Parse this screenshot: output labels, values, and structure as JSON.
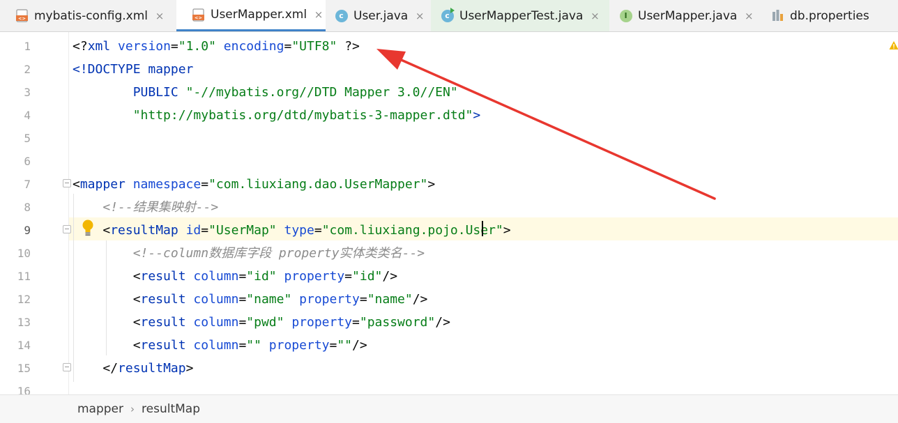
{
  "tabs": [
    {
      "label": "mybatis-config.xml",
      "icon": "xml-file-icon",
      "close": "×"
    },
    {
      "label": "UserMapper.xml",
      "icon": "xml-file-icon",
      "close": "×",
      "active": true
    },
    {
      "label": "User.java",
      "icon": "java-class-icon",
      "icon_glyph": "c",
      "close": "×"
    },
    {
      "label": "UserMapperTest.java",
      "icon": "java-test-class-icon",
      "icon_glyph": "c",
      "close": "×"
    },
    {
      "label": "UserMapper.java",
      "icon": "java-interface-icon",
      "icon_glyph": "I",
      "close": "×"
    },
    {
      "label": "db.properties",
      "icon": "properties-file-icon"
    }
  ],
  "editor": {
    "line_numbers": [
      "1",
      "2",
      "3",
      "4",
      "5",
      "6",
      "7",
      "8",
      "9",
      "10",
      "11",
      "12",
      "13",
      "14",
      "15",
      "16"
    ],
    "current_line": "9",
    "lines": [
      [
        {
          "t": "<?",
          "c": "punct"
        },
        {
          "t": "xml ",
          "c": "tag"
        },
        {
          "t": "version",
          "c": "attr"
        },
        {
          "t": "=",
          "c": "punct"
        },
        {
          "t": "\"1.0\" ",
          "c": "str"
        },
        {
          "t": "encoding",
          "c": "attr"
        },
        {
          "t": "=",
          "c": "punct"
        },
        {
          "t": "\"UTF8\" ",
          "c": "str"
        },
        {
          "t": "?>",
          "c": "punct"
        }
      ],
      [
        {
          "t": "<!DOCTYPE ",
          "c": "tag"
        },
        {
          "t": "mapper",
          "c": "tag"
        }
      ],
      [
        {
          "t": "        ",
          "c": "punct"
        },
        {
          "t": "PUBLIC ",
          "c": "kw"
        },
        {
          "t": "\"-//mybatis.org//DTD Mapper 3.0//EN\"",
          "c": "str"
        }
      ],
      [
        {
          "t": "        ",
          "c": "punct"
        },
        {
          "t": "\"http://mybatis.org/dtd/mybatis-3-mapper.dtd\"",
          "c": "str"
        },
        {
          "t": ">",
          "c": "tag"
        }
      ],
      [],
      [],
      [
        {
          "t": "<",
          "c": "punct"
        },
        {
          "t": "mapper ",
          "c": "tag"
        },
        {
          "t": "namespace",
          "c": "attr"
        },
        {
          "t": "=",
          "c": "punct"
        },
        {
          "t": "\"com.liuxiang.dao.UserMapper\"",
          "c": "str"
        },
        {
          "t": ">",
          "c": "punct"
        }
      ],
      [
        {
          "t": "    ",
          "c": "punct"
        },
        {
          "t": "<!--结果集映射-->",
          "c": "comment"
        }
      ],
      [
        {
          "t": "    ",
          "c": "punct"
        },
        {
          "t": "<",
          "c": "punct"
        },
        {
          "t": "resultMap ",
          "c": "tag"
        },
        {
          "t": "id",
          "c": "attr"
        },
        {
          "t": "=",
          "c": "punct"
        },
        {
          "t": "\"UserMap\" ",
          "c": "str"
        },
        {
          "t": "type",
          "c": "attr"
        },
        {
          "t": "=",
          "c": "punct"
        },
        {
          "t": "\"com.liuxiang.pojo.User\"",
          "c": "str"
        },
        {
          "t": ">",
          "c": "punct"
        }
      ],
      [
        {
          "t": "        ",
          "c": "punct"
        },
        {
          "t": "<!--column数据库字段 property实体类类名-->",
          "c": "comment"
        }
      ],
      [
        {
          "t": "        ",
          "c": "punct"
        },
        {
          "t": "<",
          "c": "punct"
        },
        {
          "t": "result ",
          "c": "tag"
        },
        {
          "t": "column",
          "c": "attr"
        },
        {
          "t": "=",
          "c": "punct"
        },
        {
          "t": "\"id\" ",
          "c": "str"
        },
        {
          "t": "property",
          "c": "attr"
        },
        {
          "t": "=",
          "c": "punct"
        },
        {
          "t": "\"id\"",
          "c": "str"
        },
        {
          "t": "/>",
          "c": "punct"
        }
      ],
      [
        {
          "t": "        ",
          "c": "punct"
        },
        {
          "t": "<",
          "c": "punct"
        },
        {
          "t": "result ",
          "c": "tag"
        },
        {
          "t": "column",
          "c": "attr"
        },
        {
          "t": "=",
          "c": "punct"
        },
        {
          "t": "\"name\" ",
          "c": "str"
        },
        {
          "t": "property",
          "c": "attr"
        },
        {
          "t": "=",
          "c": "punct"
        },
        {
          "t": "\"name\"",
          "c": "str"
        },
        {
          "t": "/>",
          "c": "punct"
        }
      ],
      [
        {
          "t": "        ",
          "c": "punct"
        },
        {
          "t": "<",
          "c": "punct"
        },
        {
          "t": "result ",
          "c": "tag"
        },
        {
          "t": "column",
          "c": "attr"
        },
        {
          "t": "=",
          "c": "punct"
        },
        {
          "t": "\"pwd\" ",
          "c": "str"
        },
        {
          "t": "property",
          "c": "attr"
        },
        {
          "t": "=",
          "c": "punct"
        },
        {
          "t": "\"password\"",
          "c": "str"
        },
        {
          "t": "/>",
          "c": "punct"
        }
      ],
      [
        {
          "t": "        ",
          "c": "punct"
        },
        {
          "t": "<",
          "c": "punct"
        },
        {
          "t": "result ",
          "c": "tag"
        },
        {
          "t": "column",
          "c": "attr"
        },
        {
          "t": "=",
          "c": "punct"
        },
        {
          "t": "\"\" ",
          "c": "str"
        },
        {
          "t": "property",
          "c": "attr"
        },
        {
          "t": "=",
          "c": "punct"
        },
        {
          "t": "\"\"",
          "c": "str"
        },
        {
          "t": "/>",
          "c": "punct"
        }
      ],
      [
        {
          "t": "    ",
          "c": "punct"
        },
        {
          "t": "</",
          "c": "punct"
        },
        {
          "t": "resultMap",
          "c": "tag"
        },
        {
          "t": ">",
          "c": "punct"
        }
      ],
      []
    ]
  },
  "breadcrumb": {
    "items": [
      "mapper",
      "resultMap"
    ],
    "separator": "›"
  },
  "colors": {
    "tag": "#0033b3",
    "attr": "#174ad4",
    "string": "#067d17",
    "comment": "#8c8c8c",
    "current_line_bg": "#fffae3",
    "annotation_arrow": "#e8372f",
    "tab_underline": "#4083c9"
  },
  "annotation": {
    "icon": "red-arrow-annotation",
    "points_to": "encoding"
  }
}
